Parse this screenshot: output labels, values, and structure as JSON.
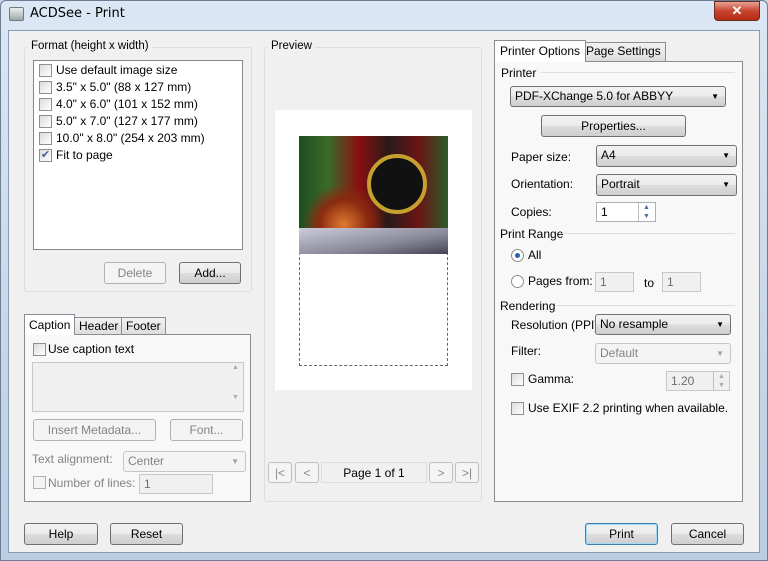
{
  "window": {
    "title": "ACDSee - Print",
    "close": "✕"
  },
  "format": {
    "legend": "Format (height x width)",
    "items": [
      {
        "label": "Use default image size",
        "checked": false
      },
      {
        "label": "3.5\" x 5.0\" (88 x 127 mm)",
        "checked": false
      },
      {
        "label": "4.0\" x 6.0\" (101 x 152 mm)",
        "checked": false
      },
      {
        "label": "5.0\" x 7.0\" (127 x 177 mm)",
        "checked": false
      },
      {
        "label": "10.0\" x 8.0\" (254 x 203 mm)",
        "checked": false
      },
      {
        "label": "Fit to page",
        "checked": true
      }
    ],
    "delete": "Delete",
    "add": "Add..."
  },
  "caption": {
    "tabs": [
      "Caption",
      "Header",
      "Footer"
    ],
    "use_caption": "Use caption text",
    "insert_metadata": "Insert Metadata...",
    "font": "Font...",
    "text_alignment_label": "Text alignment:",
    "text_alignment": "Center",
    "number_of_lines_label": "Number of lines:",
    "number_of_lines": "1"
  },
  "preview": {
    "legend": "Preview",
    "page": "Page 1 of 1",
    "first": "|<",
    "prev": "<",
    "next": ">",
    "last": ">|"
  },
  "options": {
    "tabs": [
      "Printer Options",
      "Page Settings"
    ],
    "printer_legend": "Printer",
    "printer": "PDF-XChange 5.0 for ABBYY",
    "properties": "Properties...",
    "paper_size_label": "Paper size:",
    "paper_size": "A4",
    "orientation_label": "Orientation:",
    "orientation": "Portrait",
    "copies_label": "Copies:",
    "copies": "1",
    "range_legend": "Print Range",
    "all": "All",
    "pages_from": "Pages from:",
    "from": "1",
    "to_label": "to",
    "to": "1",
    "rendering_legend": "Rendering",
    "resolution_label": "Resolution (PPI):",
    "resolution": "No resample",
    "filter_label": "Filter:",
    "filter": "Default",
    "gamma_label": "Gamma:",
    "gamma": "1.20",
    "exif": "Use EXIF 2.2 printing when available."
  },
  "footer": {
    "help": "Help",
    "reset": "Reset",
    "print": "Print",
    "cancel": "Cancel"
  }
}
